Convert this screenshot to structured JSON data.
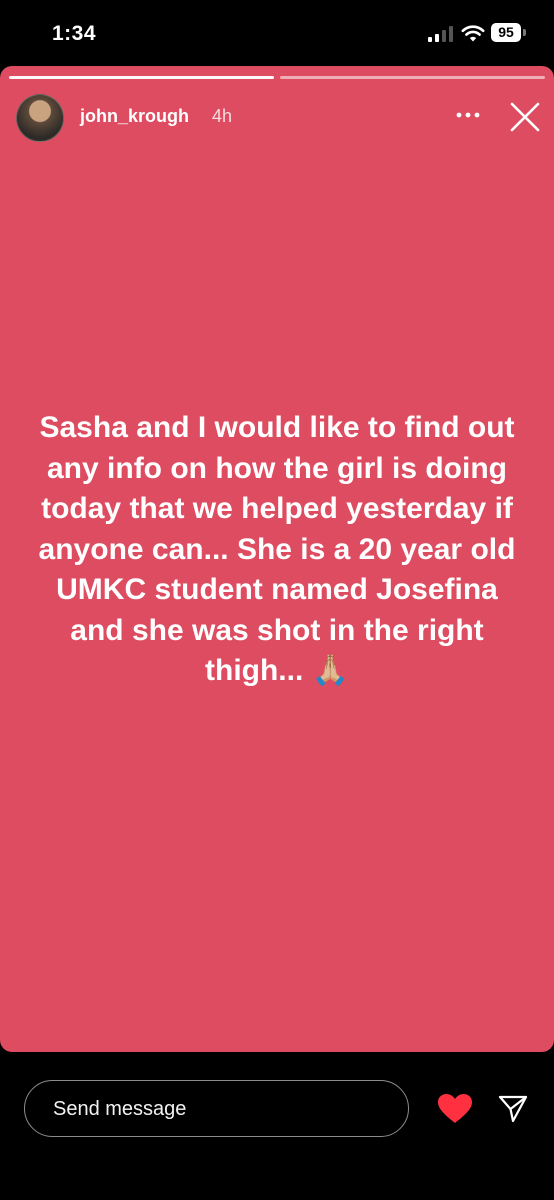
{
  "status_bar": {
    "time": "1:34",
    "battery": "95",
    "icons": [
      "cellular-signal-icon",
      "wifi-icon",
      "battery-icon"
    ]
  },
  "story": {
    "background_color": "#dd4c60",
    "progress_segments": [
      {
        "state": "viewed",
        "fill": 1.0
      },
      {
        "state": "current",
        "fill": 0.0
      }
    ],
    "user": {
      "username": "john_krough",
      "time_ago": "4h"
    },
    "text": "Sasha and I would like to find out any info on how the girl is doing today that we helped yesterday if anyone can... She is a 20 year old UMKC student named Josefina and she was shot in the right thigh... 🙏🏼",
    "icons": [
      "more-options-icon",
      "close-icon"
    ]
  },
  "reply_bar": {
    "message_placeholder": "Send message",
    "icons": [
      "heart-icon",
      "send-icon"
    ],
    "heart_color": "#ff3040"
  }
}
